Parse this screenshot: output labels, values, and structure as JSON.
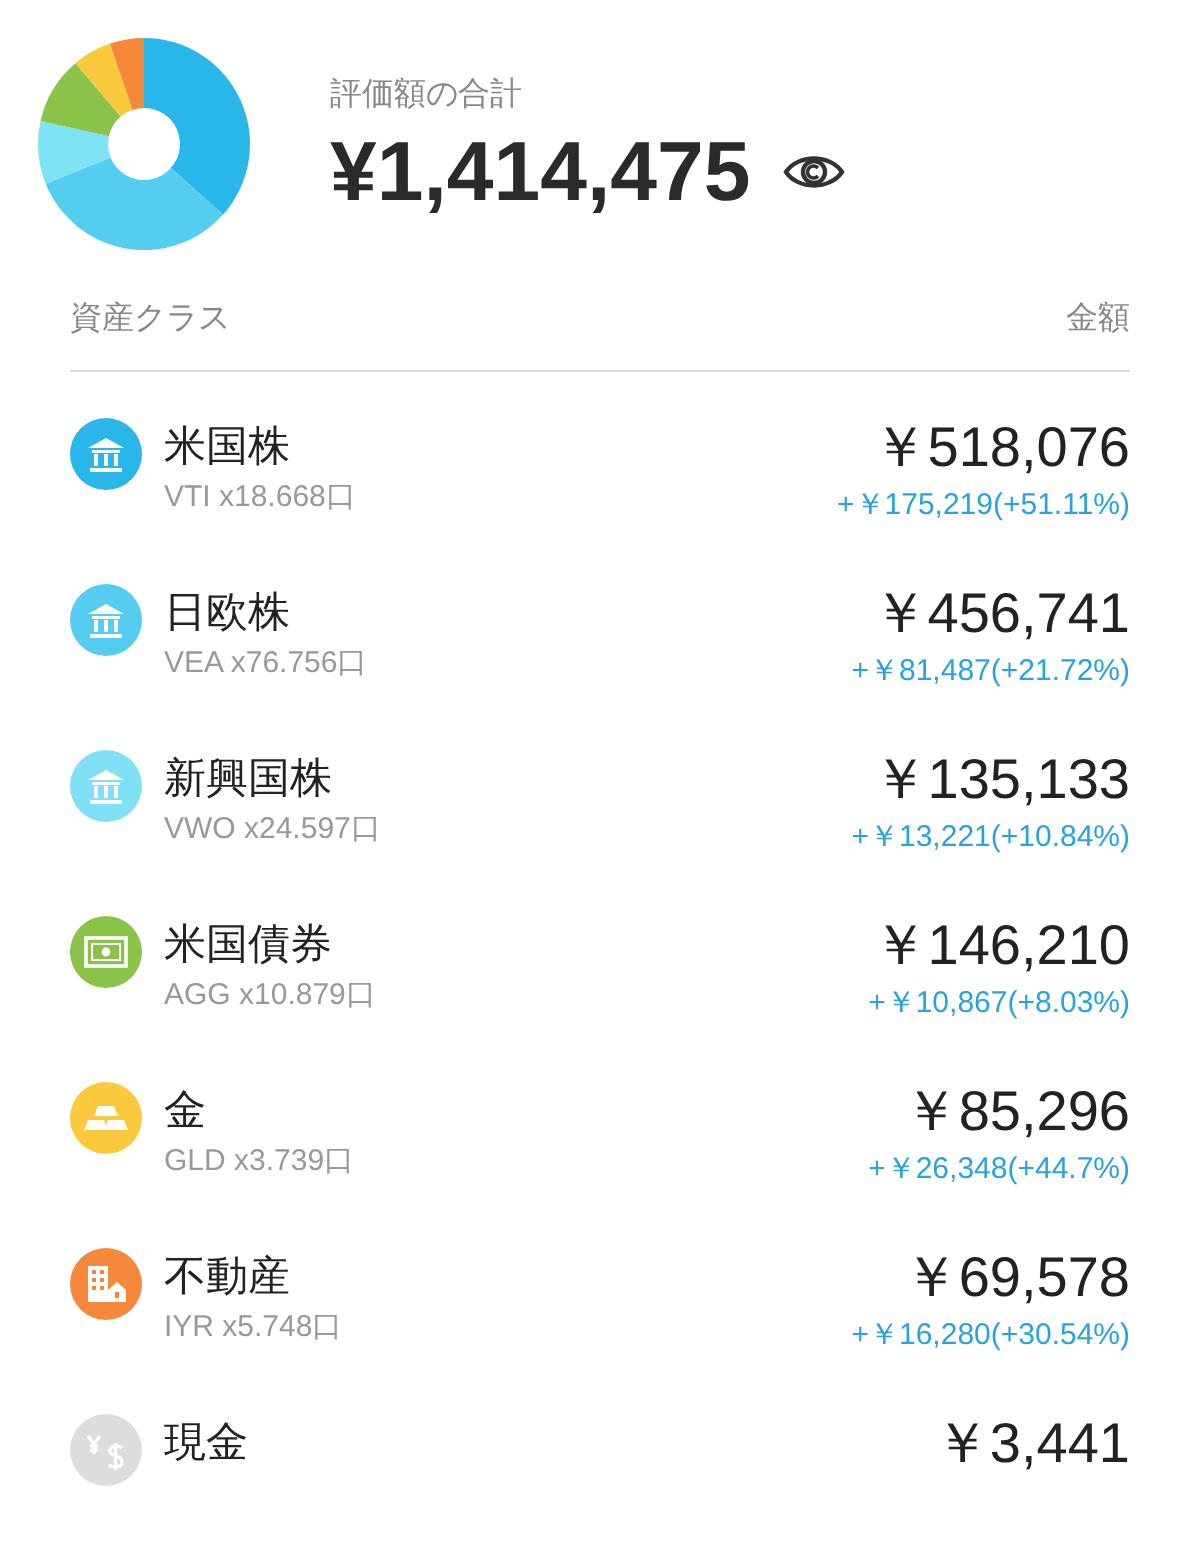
{
  "summary": {
    "label": "評価額の合計",
    "total": "¥1,414,475"
  },
  "list_header": {
    "left": "資産クラス",
    "right": "金額"
  },
  "assets": [
    {
      "kind": "bank",
      "color": "#29b6e8",
      "name": "米国株",
      "holding": "VTI x18.668口",
      "amount": "￥518,076",
      "gain": "+￥175,219(+51.11%)"
    },
    {
      "kind": "bank",
      "color": "#55cdf0",
      "name": "日欧株",
      "holding": "VEA x76.756口",
      "amount": "￥456,741",
      "gain": "+￥81,487(+21.72%)"
    },
    {
      "kind": "bank",
      "color": "#7fe0f6",
      "name": "新興国株",
      "holding": "VWO x24.597口",
      "amount": "￥135,133",
      "gain": "+￥13,221(+10.84%)"
    },
    {
      "kind": "bond",
      "color": "#8bc34a",
      "name": "米国債券",
      "holding": "AGG x10.879口",
      "amount": "￥146,210",
      "gain": "+￥10,867(+8.03%)"
    },
    {
      "kind": "gold",
      "color": "#fbc93d",
      "name": "金",
      "holding": "GLD x3.739口",
      "amount": "￥85,296",
      "gain": "+￥26,348(+44.7%)"
    },
    {
      "kind": "realestate",
      "color": "#f5883a",
      "name": "不動産",
      "holding": "IYR x5.748口",
      "amount": "￥69,578",
      "gain": "+￥16,280(+30.54%)"
    },
    {
      "kind": "cash",
      "color": "#dddddd",
      "name": "現金",
      "amount": "￥3,441"
    }
  ]
}
